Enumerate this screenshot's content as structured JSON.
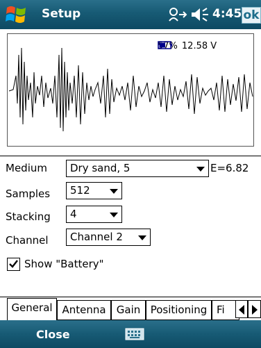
{
  "titlebar": {
    "title": "Setup",
    "clock": "4:45",
    "ok_label": "ok",
    "icons": [
      "windows-start-icon",
      "connectivity-icon",
      "speaker-icon"
    ]
  },
  "scope": {
    "battery_percent": "57%",
    "battery_voltage": "12.58 V",
    "battery_level": 0.57
  },
  "form": {
    "medium": {
      "label": "Medium",
      "value": "Dry sand, 5",
      "extra": "E=6.82"
    },
    "samples": {
      "label": "Samples",
      "value": "512"
    },
    "stacking": {
      "label": "Stacking",
      "value": "4"
    },
    "channel": {
      "label": "Channel",
      "value": "Channel 2"
    },
    "show_battery": {
      "label": "Show \"Battery\"",
      "checked": true
    }
  },
  "tabs": {
    "items": [
      "General",
      "Antenna",
      "Gain",
      "Positioning",
      "Fi"
    ],
    "active": "General"
  },
  "menubar": {
    "left_softkey": "Close",
    "icons": [
      "keyboard-icon"
    ]
  },
  "colors": {
    "titlebar": "#175a74",
    "ok_text": "#1c6d8a",
    "battery_icon": "#00008b"
  }
}
